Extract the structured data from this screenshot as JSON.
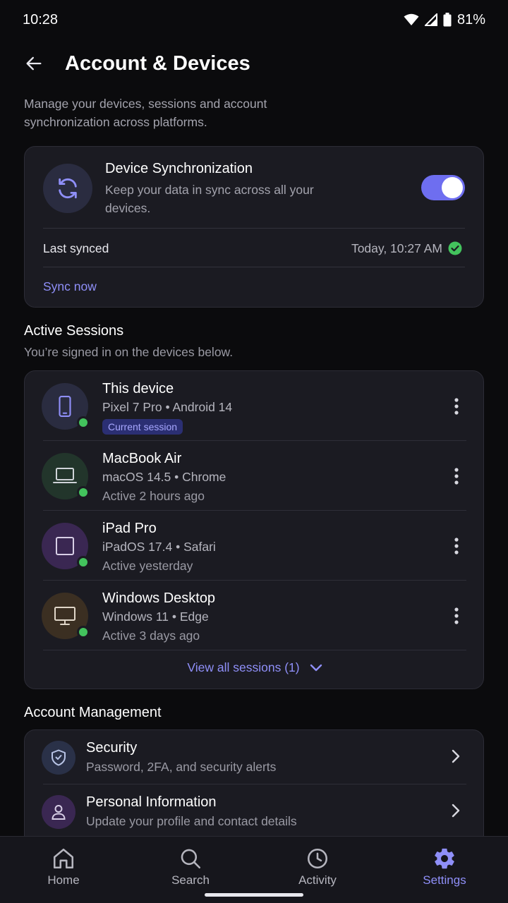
{
  "status_bar": {
    "time": "10:28",
    "battery": "81%"
  },
  "header": {
    "title": "Account & Devices",
    "description": "Manage your devices, sessions and account synchronization across platforms."
  },
  "sync": {
    "title": "Device Synchronization",
    "subtitle": "Keep your data in sync across all your devices.",
    "enabled": true,
    "last_synced_label": "Last synced",
    "last_synced_value": "Today, 10:27 AM",
    "sync_now_label": "Sync now"
  },
  "sessions": {
    "title": "Active Sessions",
    "subtitle": "You’re signed in on the devices below.",
    "items": [
      {
        "name": "This device",
        "detail": "Pixel 7 Pro • Android 14",
        "status": "Current session",
        "current": true
      },
      {
        "name": "MacBook Air",
        "detail": "macOS 14.5 • Chrome",
        "status": "Active 2 hours ago",
        "current": false
      },
      {
        "name": "iPad Pro",
        "detail": "iPadOS 17.4 • Safari",
        "status": "Active yesterday",
        "current": false
      },
      {
        "name": "Windows Desktop",
        "detail": "Windows 11 • Edge",
        "status": "Active 3 days ago",
        "current": false
      }
    ],
    "view_all_label": "View all sessions (1)"
  },
  "account": {
    "title": "Account Management",
    "items": [
      {
        "title": "Security",
        "subtitle": "Password, 2FA, and security alerts",
        "icon": "shield-icon"
      },
      {
        "title": "Personal Information",
        "subtitle": "Update your profile and contact details",
        "icon": "person-icon"
      }
    ]
  },
  "nav": {
    "items": [
      {
        "label": "Home",
        "icon": "home-icon"
      },
      {
        "label": "Search",
        "icon": "search-icon"
      },
      {
        "label": "Activity",
        "icon": "clock-icon"
      },
      {
        "label": "Settings",
        "icon": "gear-icon",
        "active": true
      }
    ]
  },
  "colors": {
    "accent": "#8f8ff8",
    "toggle": "#6e6ef0",
    "online": "#43c35d",
    "card": "#1b1b22"
  }
}
